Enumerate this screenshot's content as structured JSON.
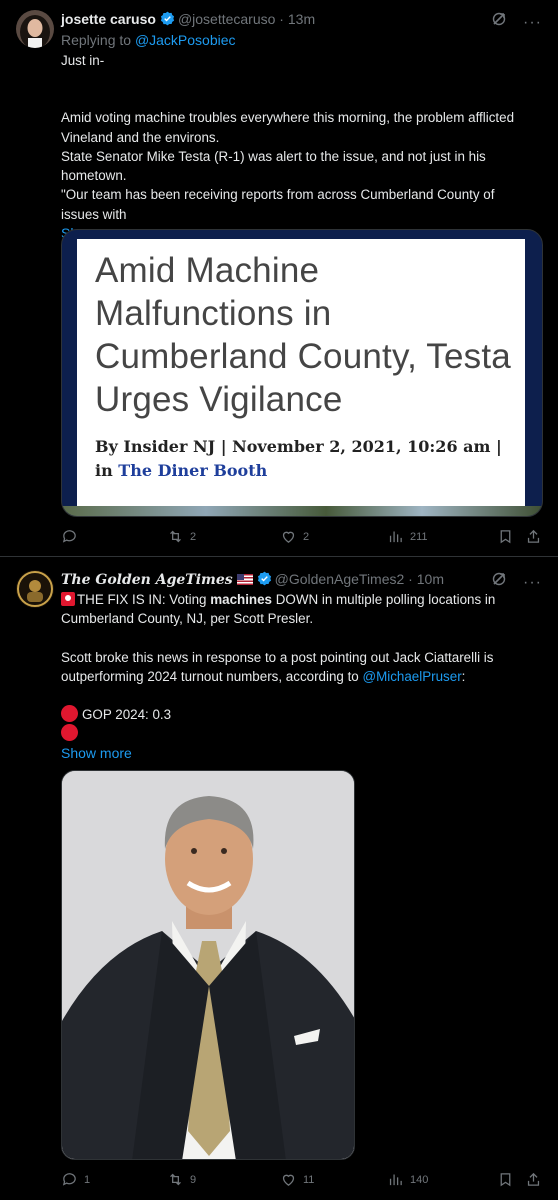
{
  "tweet1": {
    "name": "josette caruso",
    "handle": "@josettecaruso",
    "time": "13m",
    "reply_prefix": "Replying to",
    "reply_to": "@JackPosobiec",
    "paragraphs": [
      "Just in-",
      "",
      "Amid voting machine troubles everywhere this morning, the problem afflicted Vineland and the environs.",
      "State Senator Mike Testa (R-1) was alert to the issue, and not just in his hometown.",
      "\"Our team has been receiving reports from across Cumberland County of issues with"
    ],
    "show_more": "Show more",
    "card": {
      "headline": "Amid Machine Malfunctions in Cumberland County, Testa Urges Vigilance",
      "byline_prefix": "By Insider NJ | November 2, 2021, 10:26 am | in",
      "byline_link": "The Diner Booth"
    },
    "actions": {
      "replies": "",
      "reposts": "2",
      "likes": "2",
      "views": "211"
    }
  },
  "tweet2": {
    "name": "The Golden AgeTimes",
    "handle": "@GoldenAgeTimes2",
    "time": "10m",
    "line1_a": "THE FIX IS IN: Voting",
    "line1_bold": "machines",
    "line1_b": "DOWN in multiple polling locations in Cumberland County, NJ, per Scott Presler.",
    "para2": "Scott broke this news in response to a post pointing out Jack Ciattarelli is outperforming 2024 turnout numbers, according to",
    "para2_link": "@MichaelPruser",
    "para2_end": ":",
    "gop_line": "GOP 2024: 0.3",
    "show_more": "Show more",
    "actions": {
      "replies": "1",
      "reposts": "9",
      "likes": "11",
      "views": "140"
    }
  },
  "colors": {
    "background": "#000000",
    "text": "#e7e9ea",
    "muted": "#71767b",
    "link": "#1d9bf0",
    "verified": "#1d9bf0",
    "red": "#e0172f"
  },
  "icons": [
    "verified-badge-icon",
    "grok-icon",
    "more-icon",
    "reply-icon",
    "repost-icon",
    "like-icon",
    "views-icon",
    "bookmark-icon",
    "share-icon",
    "siren-icon",
    "us-flag-icon"
  ]
}
